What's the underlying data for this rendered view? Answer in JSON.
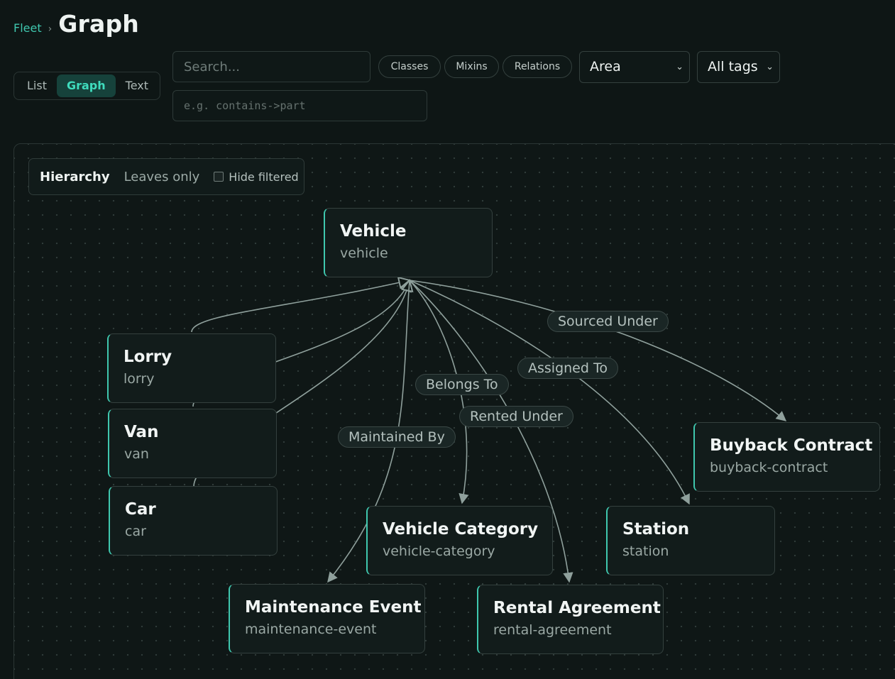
{
  "breadcrumb": {
    "parent": "Fleet",
    "separator": "›",
    "title": "Graph"
  },
  "view_modes": [
    "List",
    "Graph",
    "Text"
  ],
  "search": {
    "placeholder": "Search..."
  },
  "relation_filter": {
    "placeholder": "e.g. contains->part"
  },
  "filter_chips": [
    "Classes",
    "Mixins",
    "Relations"
  ],
  "area_select": {
    "value": "Area"
  },
  "tags_select": {
    "value": "All tags"
  },
  "layout_panel": {
    "hierarchy": "Hierarchy",
    "leaves_only": "Leaves only",
    "hide_filtered": "Hide filtered"
  },
  "nodes": [
    {
      "title": "Vehicle",
      "id": "vehicle"
    },
    {
      "title": "Lorry",
      "id": "lorry"
    },
    {
      "title": "Van",
      "id": "van"
    },
    {
      "title": "Car",
      "id": "car"
    },
    {
      "title": "Buyback Contract",
      "id": "buyback-contract"
    },
    {
      "title": "Vehicle Category",
      "id": "vehicle-category"
    },
    {
      "title": "Station",
      "id": "station"
    },
    {
      "title": "Maintenance Event",
      "id": "maintenance-event"
    },
    {
      "title": "Rental Agreement",
      "id": "rental-agreement"
    }
  ],
  "edge_labels": [
    "Sourced Under",
    "Assigned To",
    "Belongs To",
    "Rented Under",
    "Maintained By"
  ],
  "colors": {
    "accent": "#3fc7ae",
    "edge": "#8fa09c",
    "background": "#0e1615"
  }
}
